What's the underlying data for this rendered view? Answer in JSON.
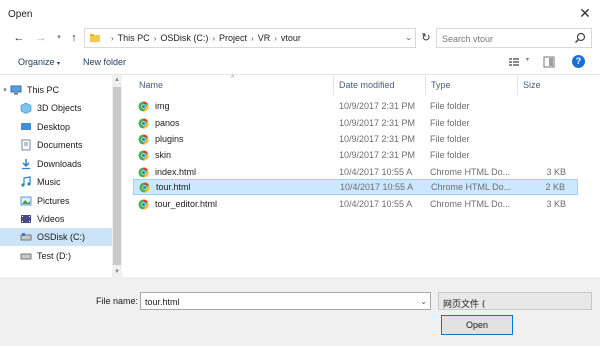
{
  "window": {
    "title": "Open"
  },
  "address": {
    "crumbs": [
      "This PC",
      "OSDisk (C:)",
      "Project",
      "VR",
      "vtour"
    ]
  },
  "search": {
    "placeholder": "Search vtour"
  },
  "toolbar": {
    "organize_label": "Organize",
    "new_folder_label": "New folder"
  },
  "sidebar": {
    "items": [
      {
        "label": "This PC",
        "icon": "computer-icon"
      },
      {
        "label": "3D Objects",
        "icon": "cube-icon"
      },
      {
        "label": "Desktop",
        "icon": "desktop-icon"
      },
      {
        "label": "Documents",
        "icon": "documents-icon"
      },
      {
        "label": "Downloads",
        "icon": "downloads-icon"
      },
      {
        "label": "Music",
        "icon": "music-icon"
      },
      {
        "label": "Pictures",
        "icon": "pictures-icon"
      },
      {
        "label": "Videos",
        "icon": "videos-icon"
      },
      {
        "label": "OSDisk (C:)",
        "icon": "drive-icon"
      },
      {
        "label": "Test (D:)",
        "icon": "drive-icon"
      }
    ]
  },
  "columns": {
    "name": "Name",
    "date": "Date modified",
    "type": "Type",
    "size": "Size"
  },
  "files": [
    {
      "name": "img",
      "date": "10/9/2017 2:31 PM",
      "type": "File folder",
      "size": "",
      "icon": "chrome-icon"
    },
    {
      "name": "panos",
      "date": "10/9/2017 2:31 PM",
      "type": "File folder",
      "size": "",
      "icon": "chrome-icon"
    },
    {
      "name": "plugins",
      "date": "10/9/2017 2:31 PM",
      "type": "File folder",
      "size": "",
      "icon": "chrome-icon"
    },
    {
      "name": "skin",
      "date": "10/9/2017 2:31 PM",
      "type": "File folder",
      "size": "",
      "icon": "chrome-icon"
    },
    {
      "name": "index.html",
      "date": "10/4/2017 10:55 A",
      "type": "Chrome HTML Do...",
      "size": "3 KB",
      "icon": "chrome-icon"
    },
    {
      "name": "tour.html",
      "date": "10/4/2017 10:55 A",
      "type": "Chrome HTML Do...",
      "size": "2 KB",
      "icon": "chrome-icon"
    },
    {
      "name": "tour_editor.html",
      "date": "10/4/2017 10:55 A",
      "type": "Chrome HTML Do...",
      "size": "3 KB",
      "icon": "chrome-icon"
    }
  ],
  "footer": {
    "filename_label": "File name:",
    "filename_value": "tour.html",
    "filter_label": "网页文件 (",
    "open_label": "Open"
  },
  "colors": {
    "selection": "#cce8ff",
    "accent": "#0078d7"
  }
}
